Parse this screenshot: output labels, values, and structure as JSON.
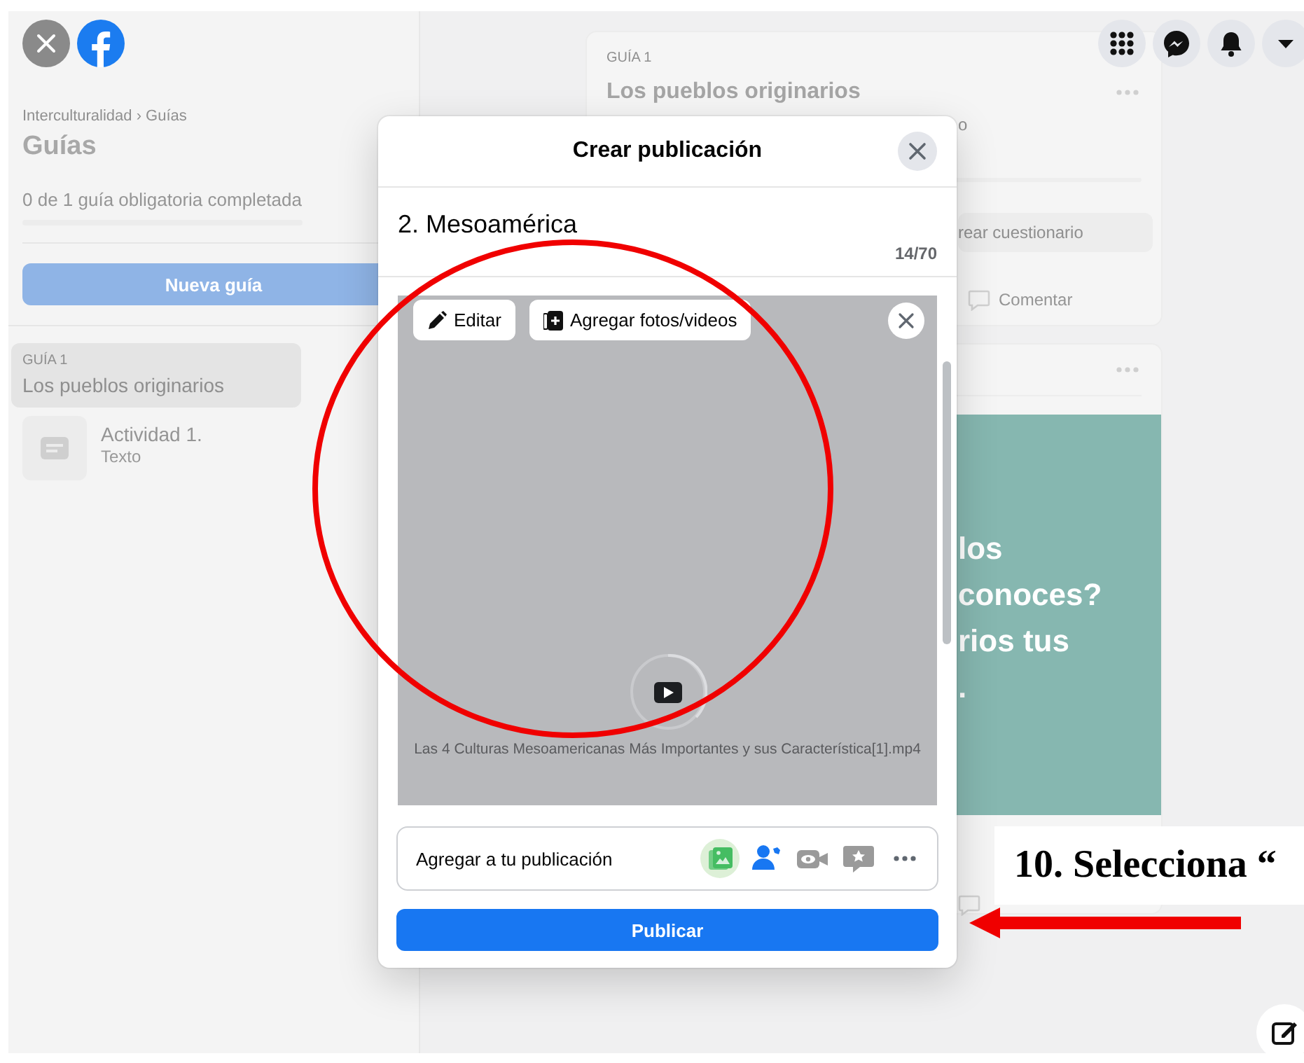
{
  "sidebar": {
    "breadcrumb": "Interculturalidad › Guías",
    "title": "Guías",
    "progress_text": "0 de 1 guía obligatoria completada",
    "new_guide_button": "Nueva guía",
    "guides": [
      {
        "label": "GUÍA 1",
        "title": "Los pueblos originarios",
        "selected": true
      }
    ],
    "activities": [
      {
        "title": "Actividad 1.",
        "type": "Texto"
      }
    ]
  },
  "feed": {
    "guide_card": {
      "label": "GUÍA 1",
      "title": "Los pueblos originarios",
      "note": "o",
      "quiz_button": "rear cuestionario",
      "comment_button": "Comentar"
    },
    "post_card": {
      "poster_lines": [
        "los",
        "conoces?",
        "rios tus",
        "."
      ]
    }
  },
  "dialog": {
    "title": "Crear publicación",
    "post_title": "2. Mesoamérica",
    "counter": "14/70",
    "media": {
      "edit_button": "Editar",
      "add_media_button": "Agregar fotos/videos",
      "file_name": "Las 4 Culturas Mesoamericanas Más Importantes y sus Característica[1].mp4"
    },
    "add_bar": {
      "label": "Agregar a tu publicación",
      "options": [
        {
          "kind": "photo",
          "selected": true
        },
        {
          "kind": "tag",
          "selected": false
        },
        {
          "kind": "live",
          "selected": false
        },
        {
          "kind": "feeling",
          "selected": false
        },
        {
          "kind": "more",
          "selected": false
        }
      ]
    },
    "publish_button": "Publicar"
  },
  "annotation": {
    "callout": "10. Selecciona “"
  }
}
